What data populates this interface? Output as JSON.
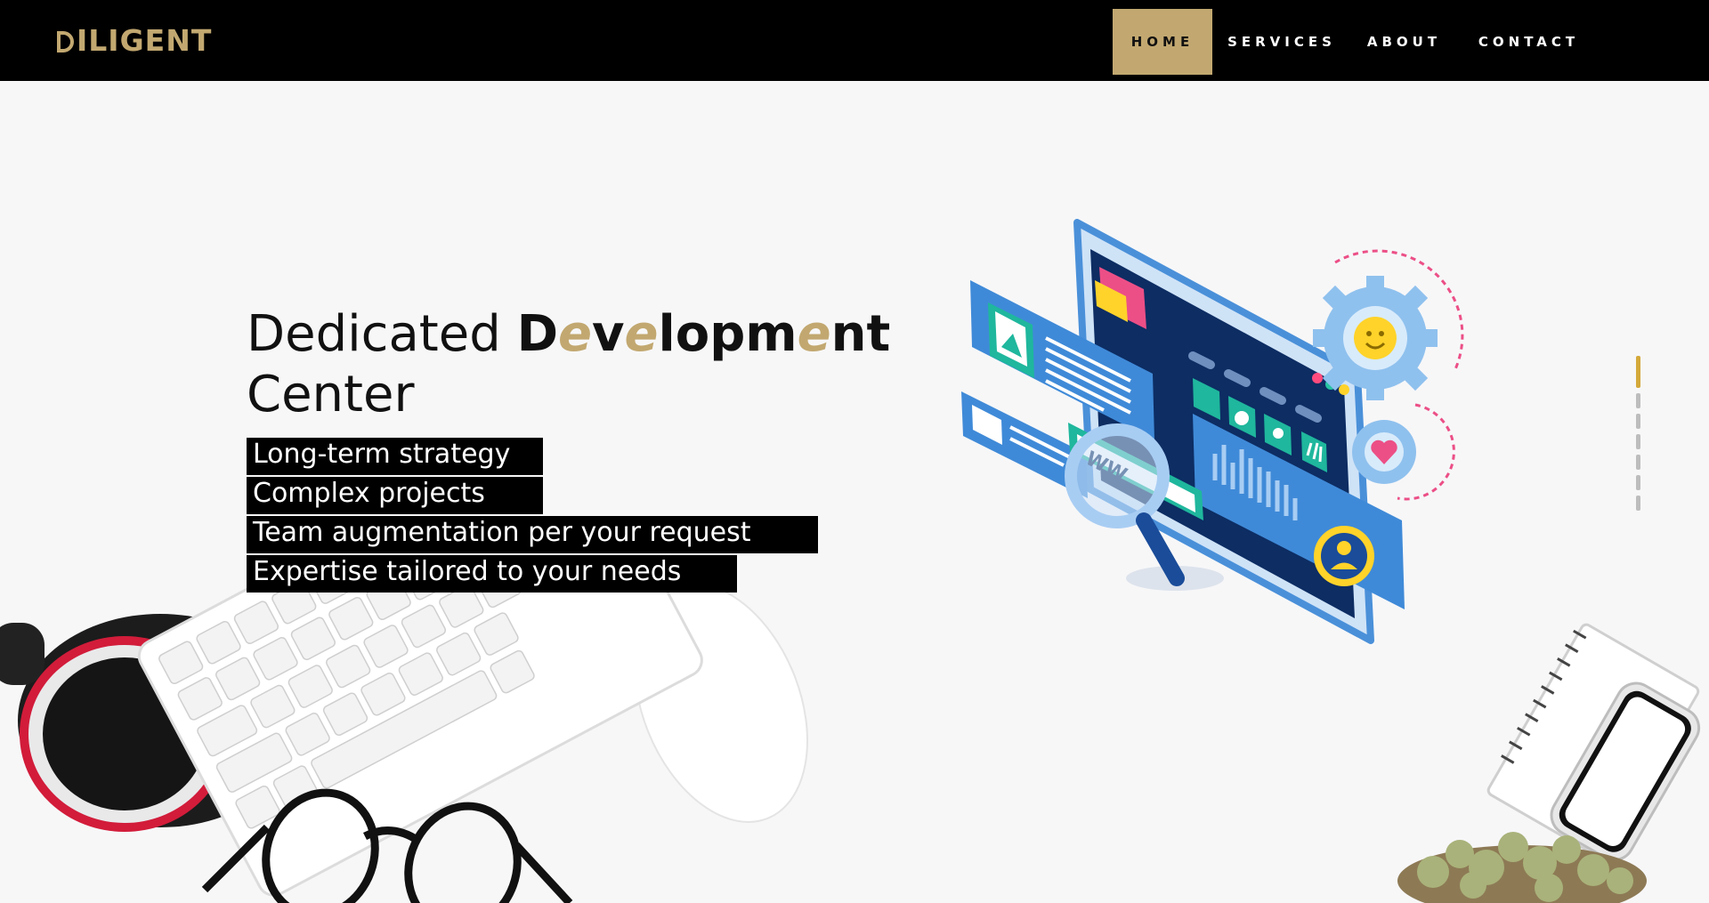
{
  "brand": {
    "logo_text": "ILIGENT"
  },
  "nav": {
    "items": [
      {
        "label": "HOME",
        "active": true
      },
      {
        "label": "SERVICES",
        "active": false
      },
      {
        "label": "ABOUT",
        "active": false
      },
      {
        "label": "CONTACT",
        "active": false
      }
    ]
  },
  "hero": {
    "title_light": "Dedicated",
    "title_bold_parts": [
      "D",
      "e",
      "v",
      "e",
      "lopm",
      "e",
      "nt"
    ],
    "title_line2": "Center",
    "bullets": [
      "Long-term strategy",
      "Complex projects",
      "Team augmentation per your request",
      "Expertise tailored to your needs"
    ]
  },
  "illustration": {
    "search_text": "WW"
  },
  "pager": {
    "slides": 6,
    "active_index": 0
  },
  "colors": {
    "accent_gold": "#c2a870",
    "nav_bg": "#000000",
    "page_bg": "#f7f7f8"
  }
}
